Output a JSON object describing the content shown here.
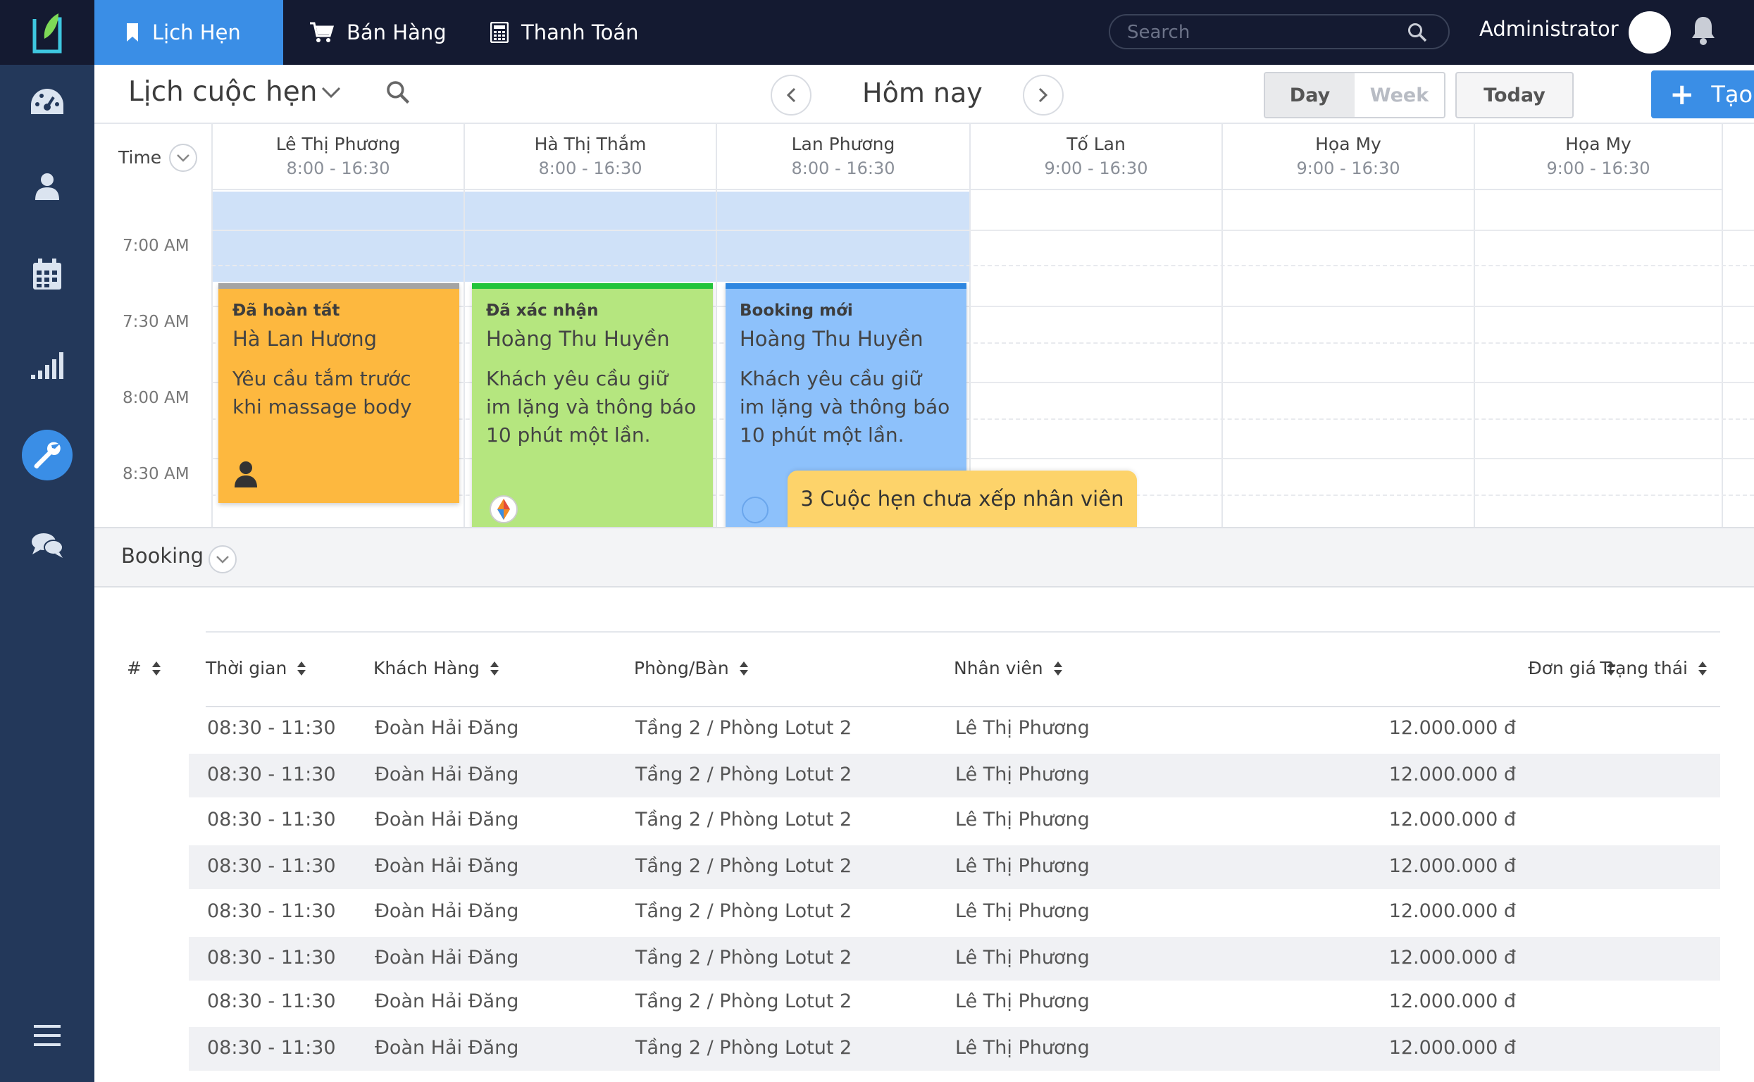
{
  "topbar": {
    "tabs": [
      {
        "label": "Lịch Hẹn",
        "icon": "bookmark-icon"
      },
      {
        "label": "Bán Hàng",
        "icon": "cart-icon"
      },
      {
        "label": "Thanh Toán",
        "icon": "calculator-icon"
      }
    ],
    "search_placeholder": "Search",
    "user": "Administrator"
  },
  "sidebar": {
    "items": [
      "dashboard-icon",
      "user-icon",
      "calendar-icon",
      "signal-icon",
      "wrench-icon",
      "chat-icon",
      "menu-icon"
    ],
    "active": "wrench-icon"
  },
  "toolbar": {
    "title": "Lịch cuộc hẹn",
    "date_label": "Hôm nay",
    "view_day": "Day",
    "view_week": "Week",
    "today": "Today",
    "create": "Tạo mới"
  },
  "calendar": {
    "time_header": "Time",
    "staff": [
      {
        "name": "Lê Thị Phương",
        "hours": "8:00 - 16:30"
      },
      {
        "name": "Hà Thị Thắm",
        "hours": "8:00 - 16:30"
      },
      {
        "name": "Lan Phương",
        "hours": "8:00 - 16:30"
      },
      {
        "name": "Tố Lan",
        "hours": "9:00 - 16:30"
      },
      {
        "name": "Họa My",
        "hours": "9:00 - 16:30"
      },
      {
        "name": "Họa My",
        "hours": "9:00 - 16:30"
      }
    ],
    "times": [
      "7:00 AM",
      "7:30 AM",
      "8:00 AM",
      "8:30 AM"
    ],
    "cards": [
      {
        "status": "Đã hoàn tất",
        "client": "Hà Lan Hương",
        "note": "Yêu cầu tắm trước khi massage body",
        "color": "#fdb83f",
        "bar": "#a4a4a4"
      },
      {
        "status": "Đã xác nhận",
        "client": "Hoàng Thu Huyền",
        "note": "Khách yêu cầu giữ im lặng và thông báo 10 phút một lần.",
        "color": "#b5e67f",
        "bar": "#22c43a"
      },
      {
        "status": "Booking mới",
        "client": "Hoàng Thu Huyền",
        "note": "Khách yêu cầu giữ im lặng và thông báo 10 phút một lần.",
        "color": "#8dc1fb",
        "bar": "#2e86e0"
      }
    ],
    "pending": "3 Cuộc hẹn chưa xếp nhân viên"
  },
  "booking": {
    "label": "Booking",
    "columns": [
      "#",
      "Thời gian",
      "Khách Hàng",
      "Phòng/Bàn",
      "Nhân viên",
      "Đơn giá",
      "Trạng thái"
    ],
    "rows": [
      {
        "time": "08:30 - 11:30",
        "customer": "Đoàn Hải Đăng",
        "room": "Tầng 2 / Phòng Lotut 2",
        "staff": "Lê Thị Phương",
        "price": "12.000.000 đ"
      },
      {
        "time": "08:30 - 11:30",
        "customer": "Đoàn Hải Đăng",
        "room": "Tầng 2 / Phòng Lotut 2",
        "staff": "Lê Thị Phương",
        "price": "12.000.000 đ"
      },
      {
        "time": "08:30 - 11:30",
        "customer": "Đoàn Hải Đăng",
        "room": "Tầng 2 / Phòng Lotut 2",
        "staff": "Lê Thị Phương",
        "price": "12.000.000 đ"
      },
      {
        "time": "08:30 - 11:30",
        "customer": "Đoàn Hải Đăng",
        "room": "Tầng 2 / Phòng Lotut 2",
        "staff": "Lê Thị Phương",
        "price": "12.000.000 đ"
      },
      {
        "time": "08:30 - 11:30",
        "customer": "Đoàn Hải Đăng",
        "room": "Tầng 2 / Phòng Lotut 2",
        "staff": "Lê Thị Phương",
        "price": "12.000.000 đ"
      },
      {
        "time": "08:30 - 11:30",
        "customer": "Đoàn Hải Đăng",
        "room": "Tầng 2 / Phòng Lotut 2",
        "staff": "Lê Thị Phương",
        "price": "12.000.000 đ"
      },
      {
        "time": "08:30 - 11:30",
        "customer": "Đoàn Hải Đăng",
        "room": "Tầng 2 / Phòng Lotut 2",
        "staff": "Lê Thị Phương",
        "price": "12.000.000 đ"
      },
      {
        "time": "08:30 - 11:30",
        "customer": "Đoàn Hải Đăng",
        "room": "Tầng 2 / Phòng Lotut 2",
        "staff": "Lê Thị Phương",
        "price": "12.000.000 đ"
      }
    ]
  },
  "colors": {
    "accent": "#3a8ee6",
    "topbar": "#141a31",
    "sidebar": "#23385a"
  }
}
